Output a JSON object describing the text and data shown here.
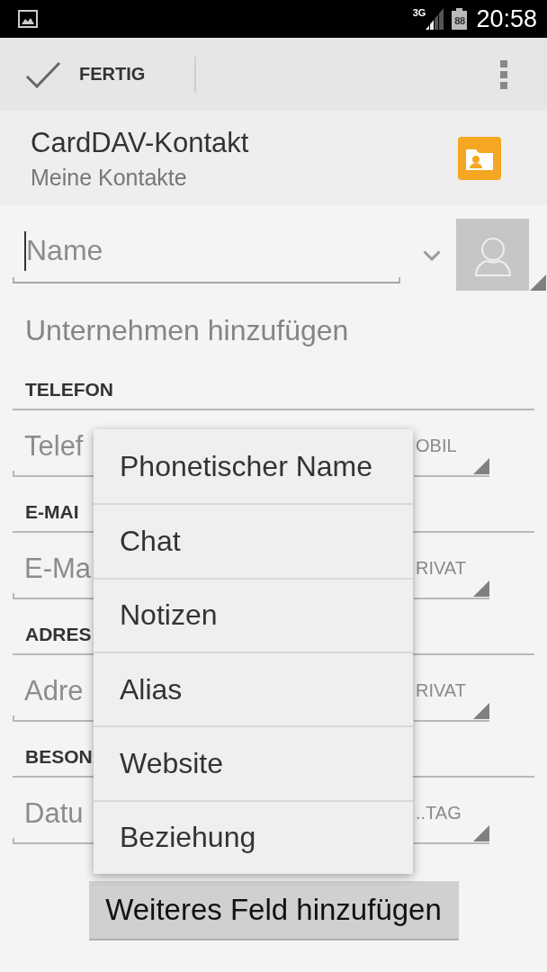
{
  "status_bar": {
    "network": "3G",
    "battery": "88",
    "time": "20:58"
  },
  "action_bar": {
    "done": "FERTIG"
  },
  "account": {
    "type": "CardDAV-Kontakt",
    "name": "Meine Kontakte"
  },
  "name_field": {
    "placeholder": "Name",
    "focused": true
  },
  "add_company": "Unternehmen hinzufügen",
  "sections": [
    {
      "title": "TELEFON",
      "placeholder": "Telef",
      "type": "OBIL"
    },
    {
      "title": "E-MAI",
      "placeholder": "E-Ma",
      "type": "RIVAT"
    },
    {
      "title": "ADRES",
      "placeholder": "Adre",
      "type": "RIVAT"
    },
    {
      "title": "BESON",
      "placeholder": "Datu",
      "type": "..TAG"
    }
  ],
  "popup_menu": {
    "items": [
      "Phonetischer Name",
      "Chat",
      "Notizen",
      "Alias",
      "Website",
      "Beziehung"
    ]
  },
  "add_field_button": "Weiteres Feld hinzufügen"
}
